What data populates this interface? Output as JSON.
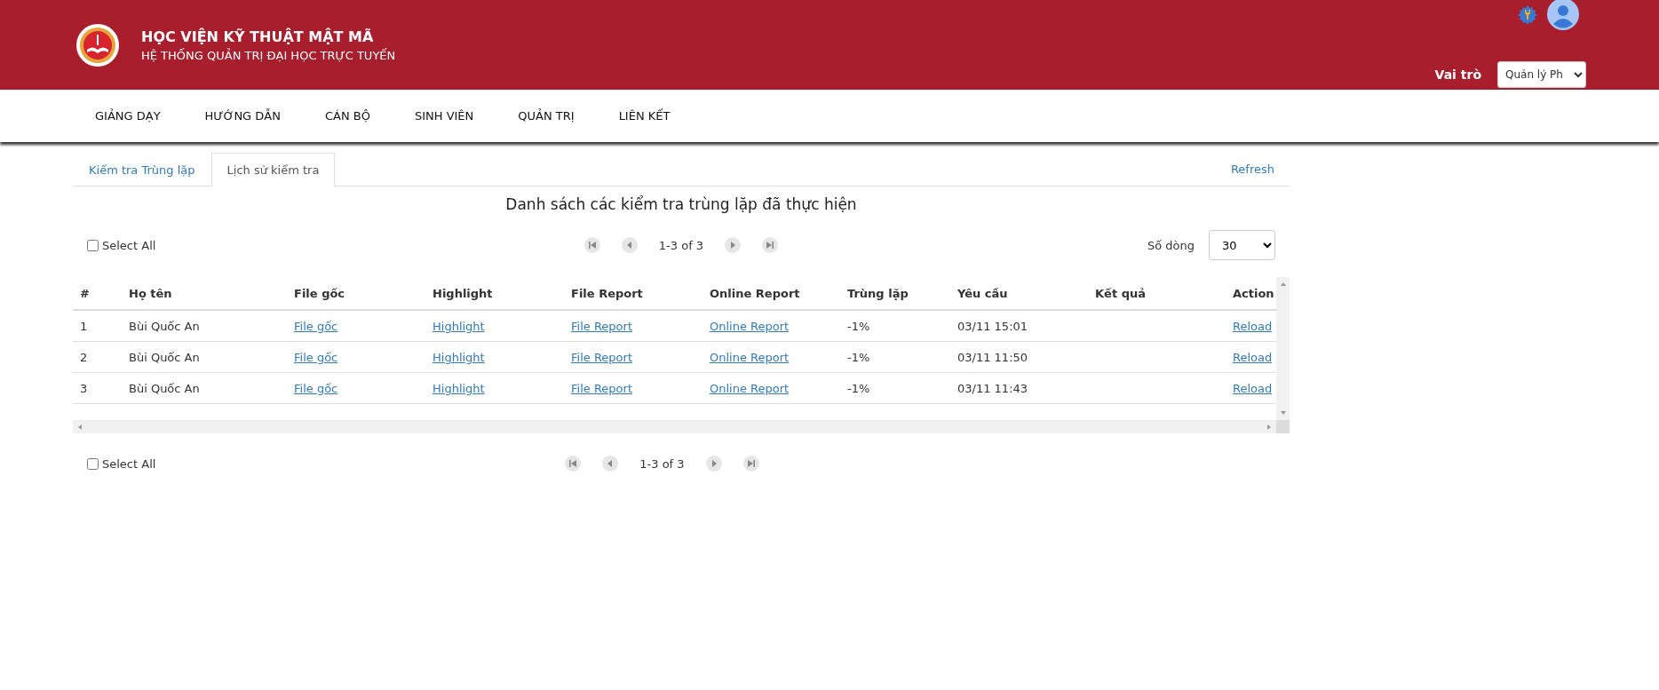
{
  "header": {
    "title": "HỌC VIỆN KỸ THUẬT MẬT MÃ",
    "subtitle": "HỆ THỐNG QUẢN TRỊ ĐẠI HỌC TRỰC TUYẾN",
    "role_label": "Vai trò",
    "role_value": "Quản lý Ph"
  },
  "nav": [
    "GIẢNG DẠY",
    "HƯỚNG DẪN",
    "CÁN BỘ",
    "SINH VIÊN",
    "QUẢN TRỊ",
    "LIÊN KẾT"
  ],
  "tabs": [
    {
      "label": "Kiểm tra Trùng lặp",
      "selected": false
    },
    {
      "label": "Lịch sử kiểm tra",
      "selected": true
    }
  ],
  "refresh": "Refresh",
  "list_title": "Danh sách các kiểm tra trùng lặp đã thực hiện",
  "top_pager": {
    "select_all": {
      "label": "Select All",
      "checked": false
    },
    "range": "1-3 of 3"
  },
  "rows_per_page": {
    "label": "Số dòng",
    "value": "30"
  },
  "table": {
    "columns": [
      "#",
      "Họ tên",
      "File gốc",
      "Highlight",
      "File Report",
      "Online Report",
      "Trùng lặp",
      "Yêu cầu",
      "Kết quả",
      "Action"
    ],
    "rows": [
      {
        "index": "1",
        "name": "Bùi Quốc An",
        "file": "File gốc",
        "highlight": "Highlight",
        "file_report": "File Report",
        "online_report": "Online Report",
        "duplicate": "-1%",
        "requested": "03/11 15:01",
        "action": "Reload"
      },
      {
        "index": "2",
        "name": "Bùi Quốc An",
        "file": "File gốc",
        "highlight": "Highlight",
        "file_report": "File Report",
        "online_report": "Online Report",
        "duplicate": "-1%",
        "requested": "03/11 11:50",
        "action": "Reload"
      },
      {
        "index": "3",
        "name": "Bùi Quốc An",
        "file": "File gốc",
        "highlight": "Highlight",
        "file_report": "File Report",
        "online_report": "Online Report",
        "duplicate": "-1%",
        "requested": "03/11 11:43",
        "action": "Reload"
      }
    ]
  },
  "bottom_pager": {
    "select_all": {
      "label": "Select All",
      "checked": false
    },
    "range": "1-3 of 3"
  }
}
